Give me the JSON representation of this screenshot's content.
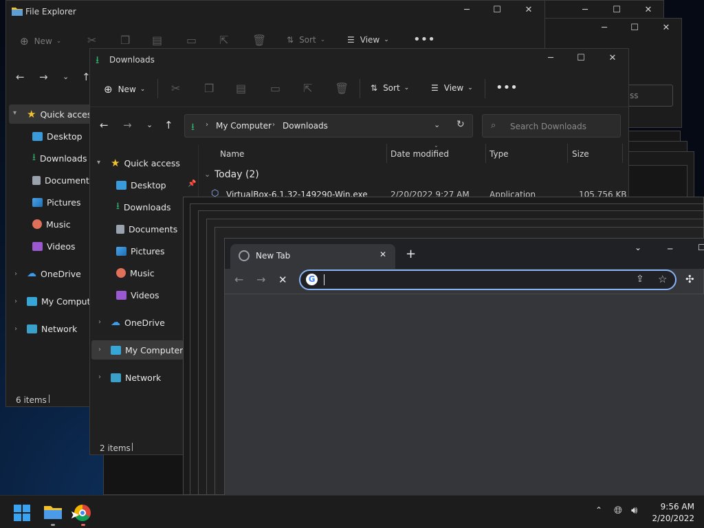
{
  "fe_back": {
    "title": "File Explorer",
    "new_label": "New",
    "sort_label": "Sort",
    "view_label": "View",
    "nav": [
      {
        "label": "Quick access"
      },
      {
        "label": "Desktop"
      },
      {
        "label": "Downloads"
      },
      {
        "label": "Documents"
      },
      {
        "label": "Pictures"
      },
      {
        "label": "Music"
      },
      {
        "label": "Videos"
      },
      {
        "label": "OneDrive"
      },
      {
        "label": "My Computer"
      },
      {
        "label": "Network"
      }
    ],
    "status": "6 items"
  },
  "fe_front": {
    "title": "Downloads",
    "new_label": "New",
    "sort_label": "Sort",
    "view_label": "View",
    "breadcrumb": [
      "My Computer",
      "Downloads"
    ],
    "search_placeholder": "Search Downloads",
    "columns": [
      "Name",
      "Date modified",
      "Type",
      "Size"
    ],
    "group_label": "Today (2)",
    "rows": [
      {
        "name": "VirtualBox-6.1.32-149290-Win.exe",
        "date": "2/20/2022 9:27 AM",
        "type": "Application",
        "size": "105,756 KB"
      }
    ],
    "nav": [
      {
        "label": "Quick access"
      },
      {
        "label": "Desktop"
      },
      {
        "label": "Downloads"
      },
      {
        "label": "Documents"
      },
      {
        "label": "Pictures"
      },
      {
        "label": "Music"
      },
      {
        "label": "Videos"
      },
      {
        "label": "OneDrive"
      },
      {
        "label": "My Computer"
      },
      {
        "label": "Network"
      }
    ],
    "status": "2 items"
  },
  "third_win": {
    "search_partial": "ss"
  },
  "browser": {
    "tab_title": "New Tab",
    "address_value": ""
  },
  "taskbar": {
    "time": "9:56 AM",
    "date": "2/20/2022"
  },
  "colors": {
    "accent_download": "#2fb36f",
    "folder_yellow": "#f2c12e",
    "selection": "#3a3a3a",
    "chrome_focus": "#8ab4f8"
  }
}
